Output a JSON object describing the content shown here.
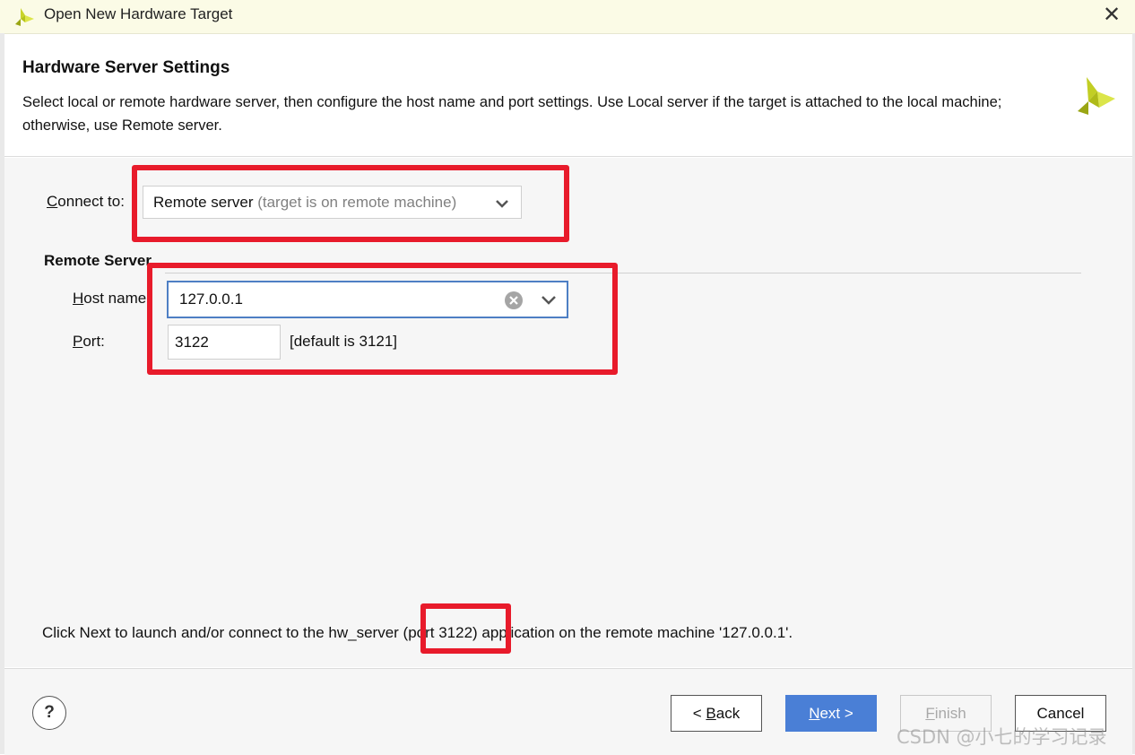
{
  "window": {
    "title": "Open New Hardware Target",
    "close_symbol": "✕"
  },
  "header": {
    "heading": "Hardware Server Settings",
    "description": "Select local or remote hardware server, then configure the host name and port settings. Use Local server if the target is attached to the local machine; otherwise, use Remote server."
  },
  "connect": {
    "label_accel": "C",
    "label_rest": "onnect to:",
    "selected_main": "Remote server",
    "selected_hint": "(target is on remote machine)"
  },
  "remote_server": {
    "heading": "Remote Server",
    "host_label_accel": "H",
    "host_label_rest": "ost name",
    "host_value": "127.0.0.1",
    "port_label_accel": "P",
    "port_label_rest": "ort:",
    "port_value": "3122",
    "port_default": "[default is 3121]"
  },
  "footer": {
    "message": "Click Next to launch and/or connect to the hw_server (port 3122) application on the remote machine '127.0.0.1'."
  },
  "buttons": {
    "help": "?",
    "back_prefix": "< ",
    "back_accel": "B",
    "back_rest": "ack",
    "next_accel": "N",
    "next_rest": "ext >",
    "finish_accel": "F",
    "finish_rest": "inish",
    "cancel": "Cancel"
  },
  "watermark": "CSDN @小七的学习记录",
  "colors": {
    "highlight": "#e81b2b",
    "primary_button": "#4a7fd6",
    "focus_border": "#4e7fc4",
    "logo": "#b8c81e"
  }
}
